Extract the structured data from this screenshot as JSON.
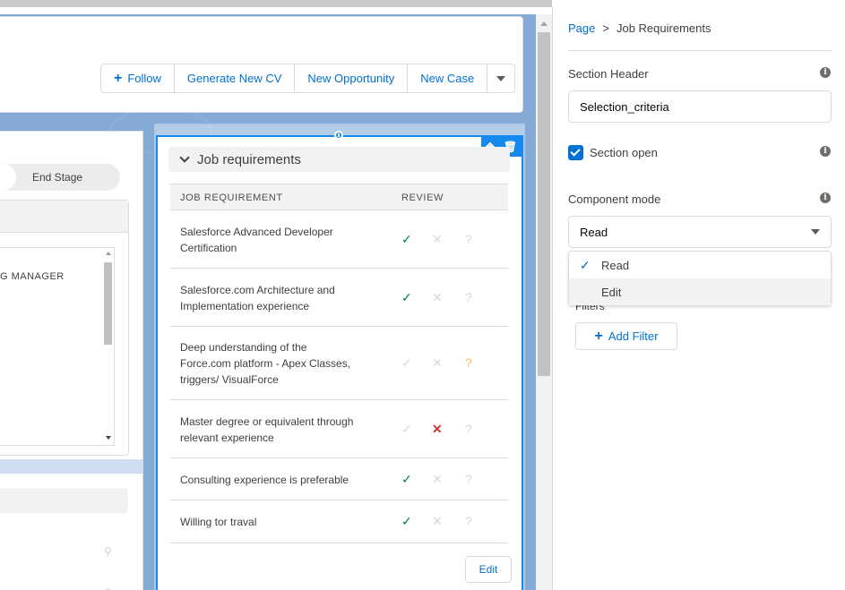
{
  "header": {
    "follow_label": "Follow",
    "actions": [
      "Generate New CV",
      "New Opportunity",
      "New Case"
    ]
  },
  "left_column": {
    "stage_label": "End Stage",
    "text_snippet": "G MANAGER"
  },
  "component": {
    "section_title": "Job requirements",
    "columns": {
      "requirement": "JOB REQUIREMENT",
      "review": "REVIEW"
    },
    "rows": [
      {
        "text": "Salesforce Advanced Developer Certification",
        "review": "ok"
      },
      {
        "text": "Salesforce.com Architecture and Implementation experience",
        "review": "ok"
      },
      {
        "text": "Deep understanding of the Force.com platform - Apex Classes, triggers/ VisualForce",
        "review": "question"
      },
      {
        "text": "Master degree or equivalent through relevant experience",
        "review": "fail"
      },
      {
        "text": "Consulting experience is preferable",
        "review": "ok"
      },
      {
        "text": "Willing tor traval",
        "review": "ok"
      }
    ],
    "edit_label": "Edit"
  },
  "panel": {
    "breadcrumb": {
      "root": "Page",
      "separator": ">",
      "current": "Job Requirements"
    },
    "section_header_label": "Section Header",
    "section_header_value": "Selection_criteria",
    "section_open_label": "Section open",
    "section_open_checked": true,
    "component_mode_label": "Component mode",
    "component_mode_value": "Read",
    "mode_options": [
      "Read",
      "Edit"
    ],
    "filters_label": "Filters",
    "add_filter_label": "Add Filter"
  },
  "colors": {
    "brand": "#0070d2",
    "selection": "#1589ee",
    "ok": "#04844b",
    "fail": "#c23934",
    "question": "#ffb75d"
  }
}
